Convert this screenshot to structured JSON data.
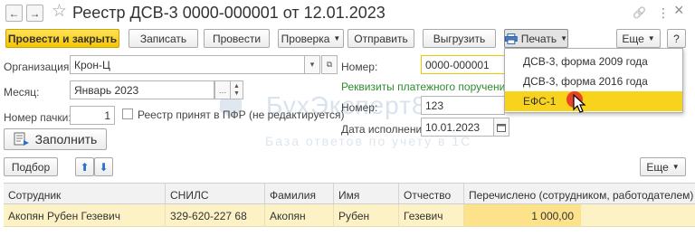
{
  "window": {
    "title": "Реестр ДСВ-3 0000-000001 от 12.01.2023",
    "back_glyph": "←",
    "forward_glyph": "→",
    "star_glyph": "☆",
    "link_glyph": "🔗",
    "more_glyph": "⋮",
    "close_glyph": "×"
  },
  "toolbar": {
    "post_and_close": "Провести и закрыть",
    "save": "Записать",
    "post": "Провести",
    "check": "Проверка",
    "send": "Отправить",
    "export": "Выгрузить",
    "print": "Печать",
    "more": "Еще",
    "help": "?"
  },
  "print_menu": {
    "items": [
      "ДСВ-3, форма 2009 года",
      "ДСВ-3, форма 2016 года",
      "ЕФС-1"
    ],
    "selected_index": 2
  },
  "form": {
    "organization_label": "Организация:",
    "organization_value": "Крон-Ц",
    "month_label": "Месяц:",
    "month_value": "Январь 2023",
    "pack_label": "Номер пачки:",
    "pack_value": "1",
    "registered_checkbox_label": "Реестр принят в ПФР (не редактируется)",
    "registered_checked": false,
    "number_label": "Номер:",
    "number_value": "0000-000001",
    "payment_section_label": "Реквизиты платежного поручения",
    "payment_number_label": "Номер:",
    "payment_number_value": "123",
    "payment_date_label": "Дата исполнения:",
    "payment_date_value": "10.01.2023",
    "fill_button": "Заполнить"
  },
  "watermark": {
    "name": "БухЭксперт8",
    "tagline": "База ответов по учету в 1С"
  },
  "table_toolbar": {
    "select_button": "Подбор",
    "up_glyph": "⬆",
    "down_glyph": "⬇",
    "more": "Еще"
  },
  "table": {
    "columns": [
      "Сотрудник",
      "СНИЛС",
      "Фамилия",
      "Имя",
      "Отчество",
      "Перечислено (сотрудником, работодателем)"
    ],
    "rows": [
      {
        "employee": "Акопян Рубен Гезевич",
        "snils": "329-620-227 68",
        "last_name": "Акопян",
        "first_name": "Рубен",
        "patronymic": "Гезевич",
        "amount": "1 000,00"
      }
    ]
  },
  "colors": {
    "accent_yellow": "#f5c400",
    "selection_yellow": "#f8d31b",
    "row_highlight": "#fcf2c6",
    "section_green": "#2e8b2e"
  }
}
